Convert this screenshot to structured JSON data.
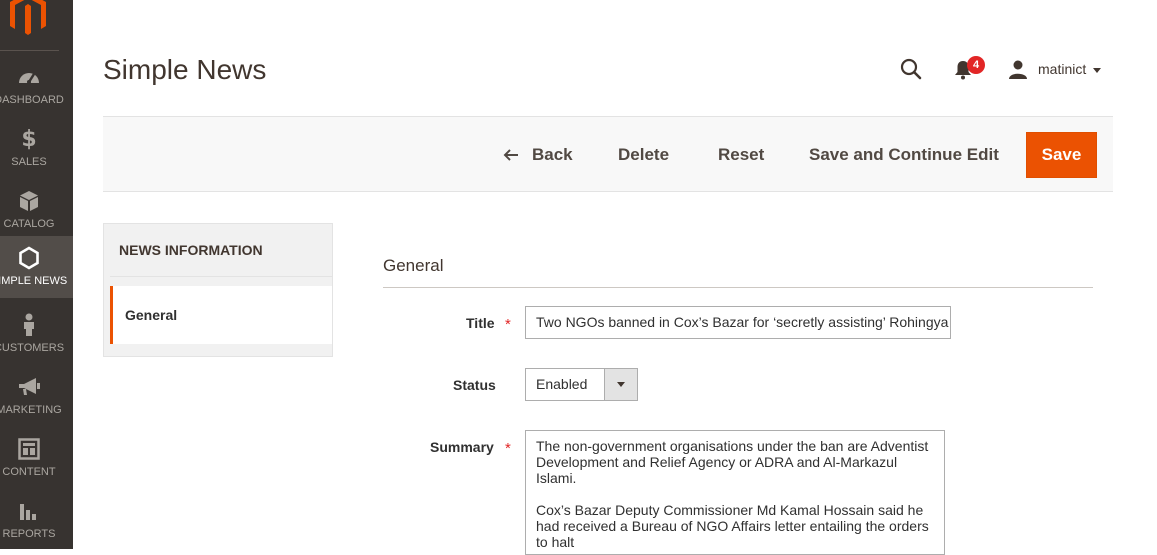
{
  "sidebar": {
    "items": [
      {
        "label": "Dashboard",
        "icon": "dashboard-icon"
      },
      {
        "label": "Sales",
        "icon": "dollar-icon"
      },
      {
        "label": "Catalog",
        "icon": "box-icon"
      },
      {
        "label": "Simple News",
        "icon": "hexagon-icon",
        "active": true
      },
      {
        "label": "Customers",
        "icon": "person-icon"
      },
      {
        "label": "Marketing",
        "icon": "megaphone-icon"
      },
      {
        "label": "Content",
        "icon": "layout-icon"
      },
      {
        "label": "Reports",
        "icon": "bar-chart-icon"
      }
    ]
  },
  "header": {
    "title": "Simple News",
    "notifications_count": "4",
    "username": "matinict"
  },
  "actions": {
    "back": "Back",
    "delete": "Delete",
    "reset": "Reset",
    "save_continue": "Save and Continue Edit",
    "save": "Save"
  },
  "tabs": {
    "title": "News Information",
    "general": "General"
  },
  "form": {
    "section_title": "General",
    "title_label": "Title",
    "title_value": "Two NGOs banned in Cox’s Bazar for ‘secretly assisting’ Rohingya",
    "status_label": "Status",
    "status_value": "Enabled",
    "summary_label": "Summary",
    "summary_p1": "The non-government organisations under the ban are Adventist Development and Relief Agency or ADRA and Al-Markazul Islami.",
    "summary_p2": "Cox’s Bazar Deputy Commissioner Md Kamal Hossain said he had received a Bureau of NGO Affairs letter entailing the orders to halt"
  },
  "colors": {
    "accent": "#eb5202",
    "sidebar_bg": "#373330",
    "badge": "#e22626"
  }
}
